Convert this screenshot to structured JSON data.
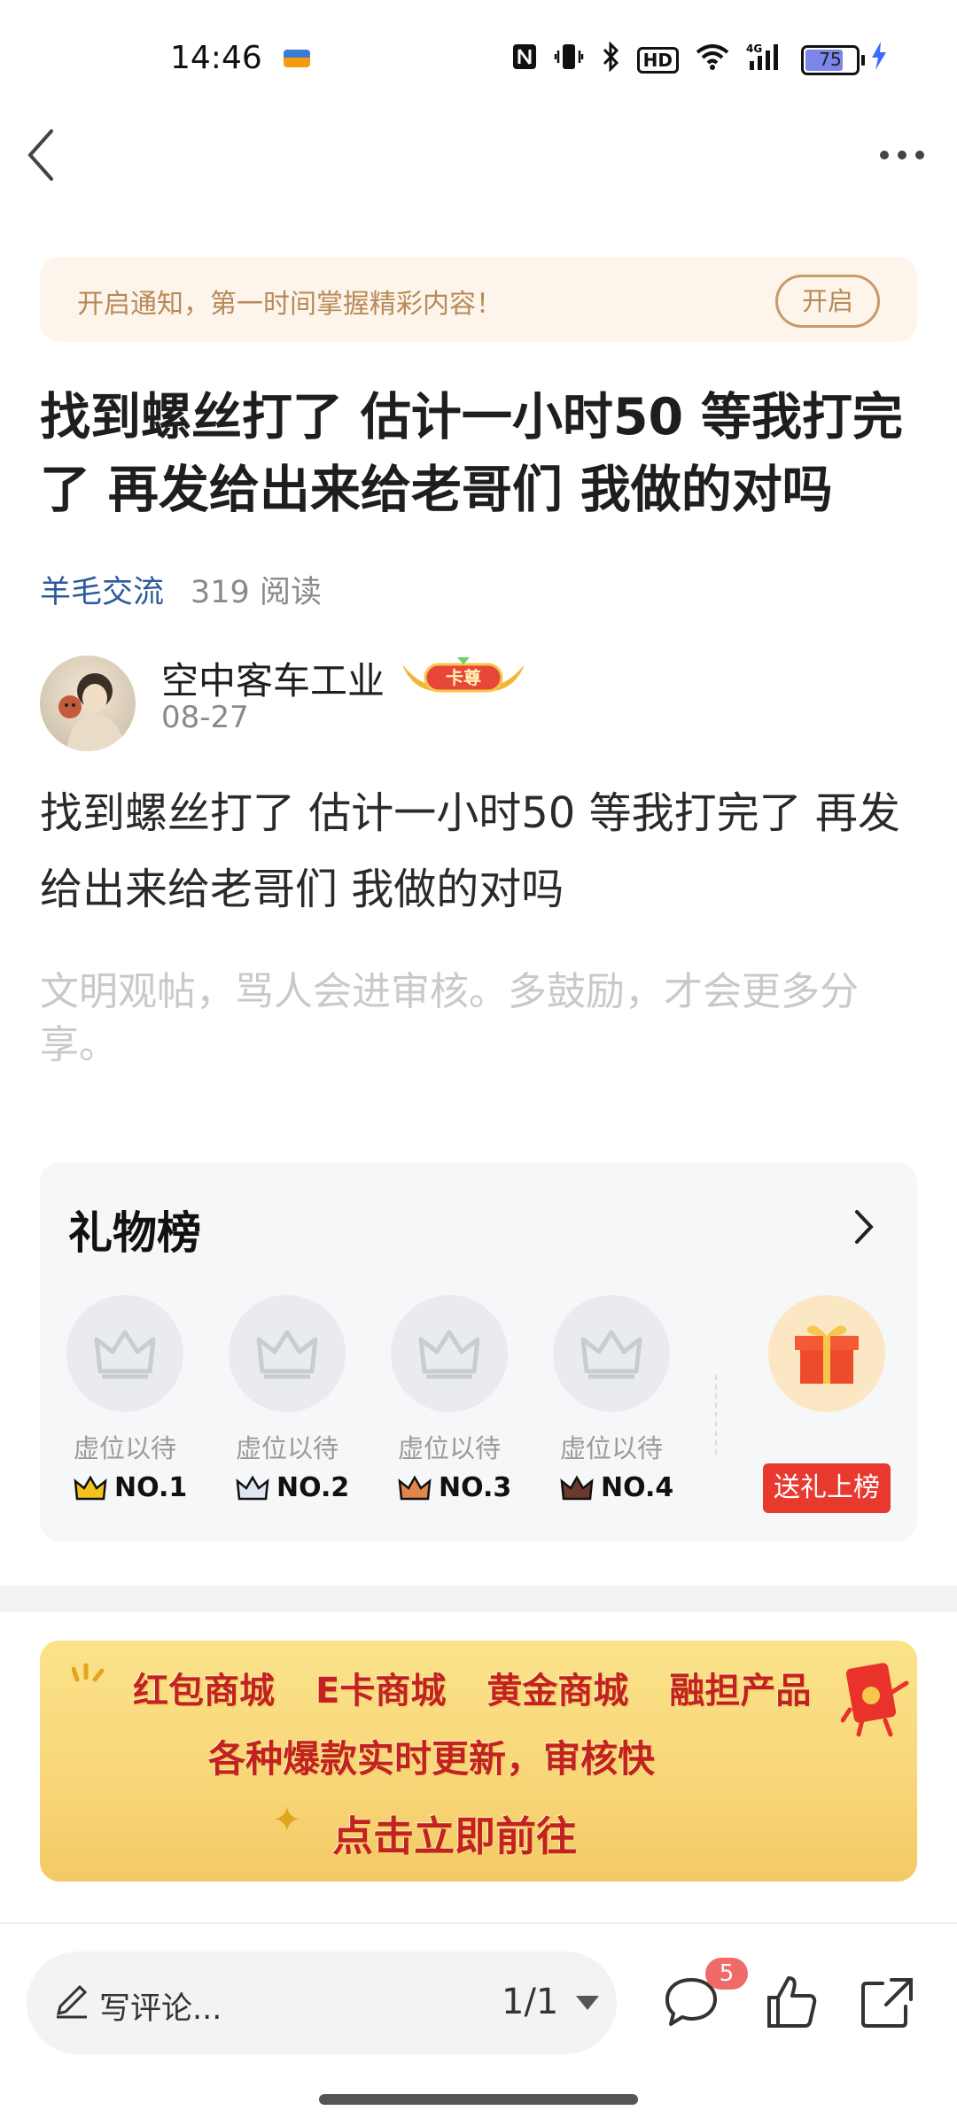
{
  "status_bar": {
    "time": "14:46",
    "battery": "75",
    "icons": [
      "nfc-icon",
      "vibrate-icon",
      "bluetooth-icon",
      "hd-icon",
      "wifi-icon",
      "signal-4g-icon",
      "battery-icon",
      "charging-icon"
    ],
    "hd_label": "HD"
  },
  "notice": {
    "text": "开启通知，第一时间掌握精彩内容！",
    "button": "开启"
  },
  "post": {
    "title": "找到螺丝打了 估计一小时50 等我打完了 再发给出来给老哥们 我做的对吗",
    "category": "羊毛交流",
    "reads": "319 阅读",
    "author": "空中客车工业",
    "badge": "卡尊",
    "date": "08-27",
    "body": "找到螺丝打了 估计一小时50 等我打完了 再发给出来给老哥们  我做的对吗",
    "hint": "文明观帖，骂人会进审核。多鼓励，才会更多分享。"
  },
  "gift_board": {
    "title": "礼物榜",
    "slots": [
      {
        "label": "虚位以待",
        "rank": "NO.1",
        "crown_color": "#f3c21b"
      },
      {
        "label": "虚位以待",
        "rank": "NO.2",
        "crown_color": "#9aa7bd"
      },
      {
        "label": "虚位以待",
        "rank": "NO.3",
        "crown_color": "#e0864a"
      },
      {
        "label": "虚位以待",
        "rank": "NO.4",
        "crown_color": "#6b3a2a"
      }
    ],
    "send_button": "送礼上榜"
  },
  "banner": {
    "items": [
      "红包商城",
      "E卡商城",
      "黄金商城",
      "融担产品"
    ],
    "line2": "各种爆款实时更新，审核快",
    "line3": "点击立即前往"
  },
  "bottom_bar": {
    "comment_placeholder": "写评论...",
    "pager": "1/1",
    "comment_count": "5"
  },
  "colors": {
    "accent_red": "#e8392e",
    "category_blue": "#2c5a9a",
    "notice_gold": "#b88a56"
  }
}
